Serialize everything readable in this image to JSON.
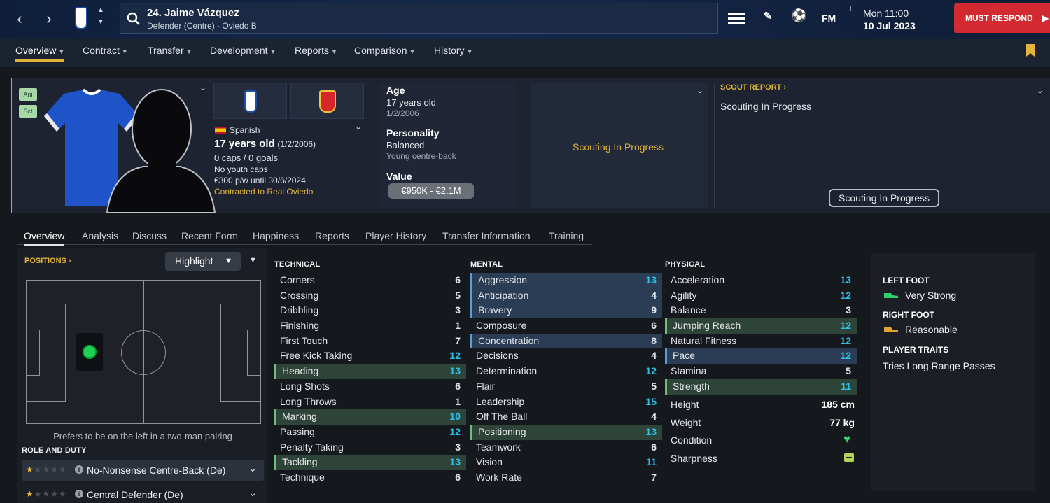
{
  "header": {
    "player_title": "24. Jaime Vázquez",
    "player_subtitle": "Defender (Centre) - Oviedo B",
    "fm_label": "FM",
    "date_line1": "Mon 11:00",
    "date_line2": "10 Jul 2023",
    "must_respond": "MUST RESPOND"
  },
  "menu": [
    "Overview",
    "Contract",
    "Transfer",
    "Development",
    "Reports",
    "Comparison",
    "History"
  ],
  "profile": {
    "btn_ani": "Ani",
    "btn_sct": "Sct",
    "nationality": "Spanish",
    "age_line": "17 years old",
    "age_dob": "(1/2/2006)",
    "caps": "0 caps / 0 goals",
    "youth_caps": "No youth caps",
    "wage": "€300 p/w until 30/6/2024",
    "contract": "Contracted to Real Oviedo"
  },
  "details": {
    "age_label": "Age",
    "age_value": "17 years old",
    "dob": "1/2/2006",
    "personality_label": "Personality",
    "personality_value": "Balanced",
    "personality_desc": "Young centre-back",
    "value_label": "Value",
    "value_range": "€950K - €2.1M"
  },
  "scouting": {
    "centre_text": "Scouting In Progress",
    "report_header": "SCOUT REPORT",
    "report_text": "Scouting In Progress",
    "button": "Scouting In Progress"
  },
  "tabs": [
    "Overview",
    "Analysis",
    "Discuss",
    "Recent Form",
    "Happiness",
    "Reports",
    "Player History",
    "Transfer Information",
    "Training"
  ],
  "positions": {
    "label": "POSITIONS",
    "view_select": "Highlight",
    "caption": "Prefers to be on the left in a two-man pairing"
  },
  "role_duty": {
    "label": "ROLE AND DUTY",
    "roles": [
      {
        "name": "No-Nonsense Centre-Back (De)",
        "stars": 1
      },
      {
        "name": "Central Defender (De)",
        "stars": 1
      }
    ]
  },
  "technical": {
    "label": "TECHNICAL",
    "attrs": [
      {
        "name": "Corners",
        "value": "6",
        "hl": ""
      },
      {
        "name": "Crossing",
        "value": "5",
        "hl": ""
      },
      {
        "name": "Dribbling",
        "value": "3",
        "hl": ""
      },
      {
        "name": "Finishing",
        "value": "1",
        "hl": ""
      },
      {
        "name": "First Touch",
        "value": "7",
        "hl": ""
      },
      {
        "name": "Free Kick Taking",
        "value": "12",
        "hl": ""
      },
      {
        "name": "Heading",
        "value": "13",
        "hl": "g"
      },
      {
        "name": "Long Shots",
        "value": "6",
        "hl": ""
      },
      {
        "name": "Long Throws",
        "value": "1",
        "hl": ""
      },
      {
        "name": "Marking",
        "value": "10",
        "hl": "g"
      },
      {
        "name": "Passing",
        "value": "12",
        "hl": ""
      },
      {
        "name": "Penalty Taking",
        "value": "3",
        "hl": ""
      },
      {
        "name": "Tackling",
        "value": "13",
        "hl": "g"
      },
      {
        "name": "Technique",
        "value": "6",
        "hl": ""
      }
    ]
  },
  "mental": {
    "label": "MENTAL",
    "attrs": [
      {
        "name": "Aggression",
        "value": "13",
        "hl": "b"
      },
      {
        "name": "Anticipation",
        "value": "4",
        "hl": "b"
      },
      {
        "name": "Bravery",
        "value": "9",
        "hl": "b"
      },
      {
        "name": "Composure",
        "value": "6",
        "hl": ""
      },
      {
        "name": "Concentration",
        "value": "8",
        "hl": "b"
      },
      {
        "name": "Decisions",
        "value": "4",
        "hl": ""
      },
      {
        "name": "Determination",
        "value": "12",
        "hl": ""
      },
      {
        "name": "Flair",
        "value": "5",
        "hl": ""
      },
      {
        "name": "Leadership",
        "value": "15",
        "hl": ""
      },
      {
        "name": "Off The Ball",
        "value": "4",
        "hl": ""
      },
      {
        "name": "Positioning",
        "value": "13",
        "hl": "g"
      },
      {
        "name": "Teamwork",
        "value": "6",
        "hl": ""
      },
      {
        "name": "Vision",
        "value": "11",
        "hl": ""
      },
      {
        "name": "Work Rate",
        "value": "7",
        "hl": ""
      }
    ]
  },
  "physical": {
    "label": "PHYSICAL",
    "attrs": [
      {
        "name": "Acceleration",
        "value": "13",
        "hl": ""
      },
      {
        "name": "Agility",
        "value": "12",
        "hl": ""
      },
      {
        "name": "Balance",
        "value": "3",
        "hl": ""
      },
      {
        "name": "Jumping Reach",
        "value": "12",
        "hl": "g"
      },
      {
        "name": "Natural Fitness",
        "value": "12",
        "hl": ""
      },
      {
        "name": "Pace",
        "value": "12",
        "hl": "b"
      },
      {
        "name": "Stamina",
        "value": "5",
        "hl": ""
      },
      {
        "name": "Strength",
        "value": "11",
        "hl": "g"
      }
    ],
    "height_label": "Height",
    "height_value": "185 cm",
    "weight_label": "Weight",
    "weight_value": "77 kg",
    "condition_label": "Condition",
    "sharpness_label": "Sharpness"
  },
  "side": {
    "left_foot_label": "LEFT FOOT",
    "left_foot_value": "Very Strong",
    "right_foot_label": "RIGHT FOOT",
    "right_foot_value": "Reasonable",
    "traits_label": "PLAYER TRAITS",
    "traits_value": "Tries Long Range Passes"
  },
  "colors": {
    "accent": "#e0b43a",
    "must_respond": "#d22a30",
    "highlight_value": "#2fc0e6",
    "green_hl": "#6cbf7c",
    "blue_hl": "#5a9bd8"
  },
  "icons": [
    "back-arrow-icon",
    "forward-arrow-icon",
    "search-icon",
    "hamburger-icon",
    "pencil-icon",
    "football-icon",
    "bookmark-icon",
    "heart-icon",
    "boot-icon"
  ]
}
